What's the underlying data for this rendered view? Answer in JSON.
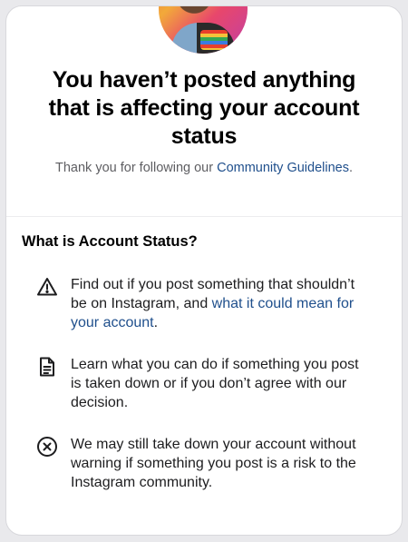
{
  "header": {
    "title_lines": [
      "You haven’t posted anything",
      "that is affecting your account",
      "status"
    ],
    "subtitle_prefix": "Thank you for following our ",
    "subtitle_link": "Community Guidelines",
    "subtitle_suffix": "."
  },
  "section": {
    "heading": "What is Account Status?",
    "items": [
      {
        "icon": "warning-triangle-icon",
        "text": "Find out if you post something that shouldn’t be on Instagram, and ",
        "link": "what it could mean for your account",
        "suffix": "."
      },
      {
        "icon": "document-icon",
        "text": "Learn what you can do if something you post is taken down or if you don’t agree with our decision."
      },
      {
        "icon": "circle-x-icon",
        "text": "We may still take down your account without warning if something you post is a risk to the Instagram community."
      }
    ]
  },
  "colors": {
    "link": "#1f4f8c",
    "subtitle": "#5e5e62"
  }
}
